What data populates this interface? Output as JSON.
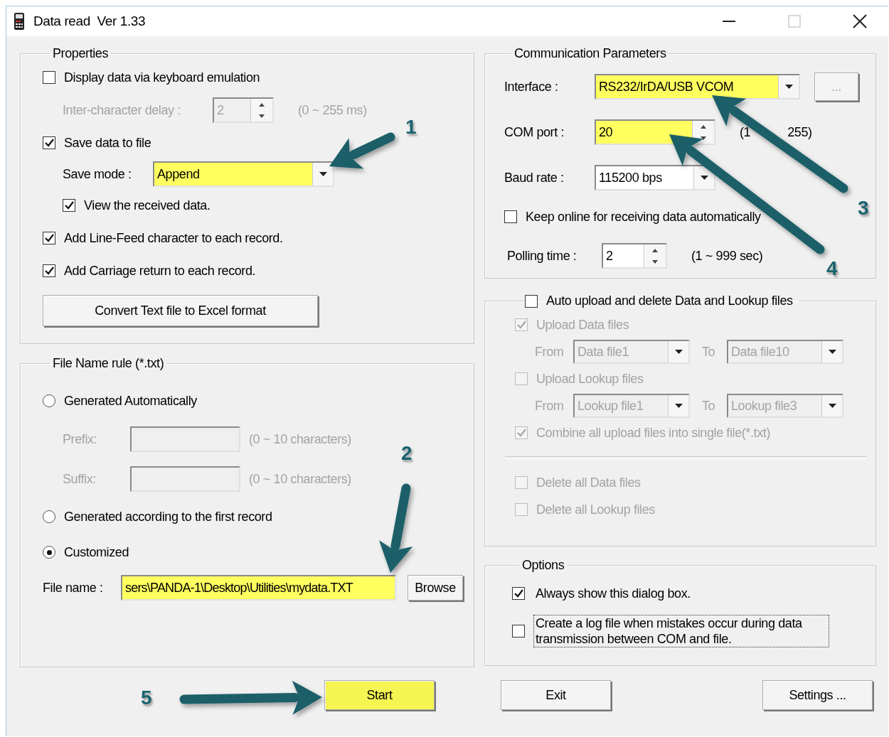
{
  "window": {
    "title": "Data read  Ver 1.33",
    "maximize_disabled": true
  },
  "properties": {
    "title": "Properties",
    "items": [
      {
        "kind": "checkbox",
        "label": "Display data via keyboard emulation",
        "checked": false
      },
      {
        "kind": "spin",
        "label": "Inter-character delay :",
        "value": "2",
        "hint": "(0 ~ 255 ms)",
        "disabled": true,
        "highlighted": false
      },
      {
        "kind": "checkbox",
        "label": "Save data to file",
        "checked": true,
        "children": [
          {
            "kind": "combo",
            "label": "Save mode :",
            "value": "Append",
            "highlighted": true
          },
          {
            "kind": "checkbox",
            "label": "View the received data.",
            "checked": true
          }
        ]
      },
      {
        "kind": "checkbox",
        "label": "Add Line-Feed character to each record.",
        "checked": true
      },
      {
        "kind": "checkbox",
        "label": "Add Carriage return to each record.",
        "checked": true
      },
      {
        "kind": "button",
        "label": "Convert Text file to Excel format"
      }
    ]
  },
  "file_name_rule": {
    "title": "File Name rule (*.txt)",
    "items": [
      {
        "kind": "radio",
        "label": "Generated Automatically",
        "selected": false,
        "children": [
          {
            "kind": "text",
            "label": "Prefix:",
            "hint": "(0 ~ 10 characters)",
            "disabled": true
          },
          {
            "kind": "text",
            "label": "Suffix:",
            "hint": "(0 ~ 10 characters)",
            "disabled": true
          }
        ]
      },
      {
        "kind": "radio",
        "label": "Generated according to the first record",
        "selected": false
      },
      {
        "kind": "radio",
        "label": "Customized",
        "selected": true
      },
      {
        "kind": "file",
        "label": "File name :",
        "value": "sers\\PANDA-1\\Desktop\\Utilities\\mydata.TXT",
        "highlighted": true,
        "button": "Browse"
      }
    ]
  },
  "communication": {
    "title": "Communication Parameters",
    "items": [
      {
        "kind": "combo",
        "label": "Interface :",
        "value": "RS232/IrDA/USB VCOM",
        "highlighted": true,
        "button": "...",
        "button_disabled": true
      },
      {
        "kind": "spin",
        "label": "COM port :",
        "value": "20",
        "hint": "(1",
        "hint_after": "255)",
        "disabled": false,
        "highlighted": true
      },
      {
        "kind": "combo",
        "label": "Baud rate :",
        "value": "115200 bps",
        "highlighted": false
      },
      {
        "kind": "checkbox",
        "label": "Keep online for receiving data automatically",
        "checked": false
      },
      {
        "kind": "spin",
        "label": "Polling time :",
        "value": "2",
        "hint": "(1 ~ 999 sec)",
        "disabled": false,
        "highlighted": false
      }
    ]
  },
  "auto_upload": {
    "title": "Auto upload and delete Data and Lookup files",
    "checked": false,
    "disabled": true,
    "items": [
      {
        "kind": "checkbox",
        "label": "Upload Data files",
        "checked": true
      },
      {
        "kind": "range",
        "from_label": "From",
        "from": "Data file1",
        "to_label": "To",
        "to": "Data file10"
      },
      {
        "kind": "checkbox",
        "label": "Upload Lookup files",
        "checked": false
      },
      {
        "kind": "range",
        "from_label": "From",
        "from": "Lookup file1",
        "to_label": "To",
        "to": "Lookup file3"
      },
      {
        "kind": "checkbox",
        "label": "Combine all upload files into single file(*.txt)",
        "checked": true
      },
      {
        "kind": "divider"
      },
      {
        "kind": "checkbox",
        "label": "Delete all Data files",
        "checked": false
      },
      {
        "kind": "checkbox",
        "label": "Delete all Lookup files",
        "checked": false
      }
    ]
  },
  "options": {
    "title": "Options",
    "items": [
      {
        "kind": "checkbox",
        "label": "Always show this dialog box.",
        "checked": true,
        "focused": false
      },
      {
        "kind": "checkbox",
        "label": "Create a log file when mistakes occur during data transmission between COM and file.",
        "checked": false,
        "focused": true
      }
    ]
  },
  "buttons": [
    {
      "label": "Start",
      "highlighted": true
    },
    {
      "label": "Exit",
      "highlighted": false
    },
    {
      "label": "Settings ...",
      "highlighted": false
    }
  ],
  "callouts": [
    {
      "number": "1"
    },
    {
      "number": "2"
    },
    {
      "number": "3"
    },
    {
      "number": "4"
    },
    {
      "number": "5"
    }
  ]
}
